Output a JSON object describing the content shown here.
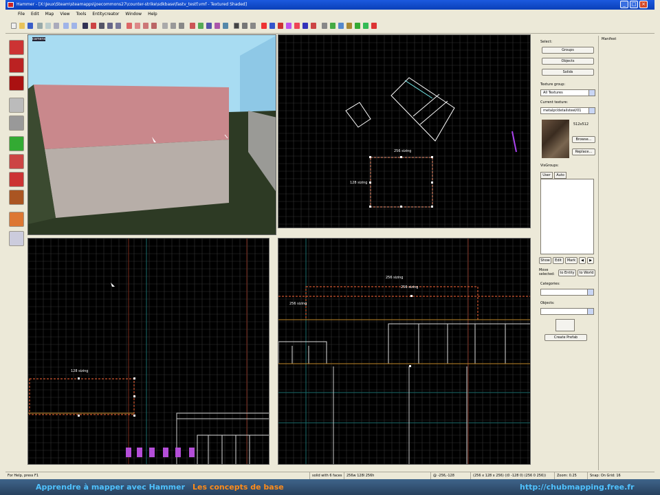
{
  "window": {
    "title": "Hammer - [X:\\Jeux\\Steam\\steamapps\\joecommons27\\counter-strike\\sdkbase\\fastv_testf.vmf - Textured Shaded]",
    "buttons": [
      "_",
      "□",
      "×"
    ]
  },
  "menu": [
    "File",
    "Edit",
    "Map",
    "View",
    "Tools",
    "Entitycreator",
    "Window",
    "Help"
  ],
  "viewports": {
    "camera": {
      "label": "camera"
    },
    "top": {
      "dim_width": "256 sizing",
      "dim_height": "128 sizing"
    },
    "front": {
      "dim_width": "128 sizing"
    },
    "side": {
      "dim_width": "256 sizing",
      "dim_width2": "256 sizing",
      "dim_height": "256 sizing"
    }
  },
  "panel": {
    "select_label": "Select:",
    "select_buttons": [
      "Groups",
      "Objects",
      "Solids"
    ],
    "texture_group_label": "Texture group:",
    "texture_group_value": "All Textures",
    "current_texture_label": "Current texture:",
    "current_texture_value": "metalpr/detailsteel/01",
    "texture_size": "512x512",
    "browse": "Browse...",
    "replace": "Replace...",
    "visgroups_label": "VisGroups:",
    "visgroups_tabs": [
      "User",
      "Auto"
    ],
    "visgroup_buttons": [
      "Show",
      "Edit",
      "Mark",
      "◀",
      "▶"
    ],
    "move_selected_label": "Move selected:",
    "move_buttons": [
      "to Entity",
      "to World"
    ],
    "categories_label": "Categories:",
    "objects_label": "Objects:",
    "create_prefab": "Create Prefab",
    "far_title": "Manifest"
  },
  "status": {
    "help": "For Help, press F1",
    "selection": "solid with 6 faces",
    "size": "256w 128l 256h",
    "coords": "@ -256,-128",
    "bounds": "(256 x 128 x 256) ((0 -128 0) (256 0 256))",
    "zoom": "Zoom: 0.25",
    "snap": "Snap: On Grid: 16"
  },
  "banner": {
    "left": "Apprendre à mapper avec Hammer",
    "middle": "Les concepts de base",
    "right": "http://chubmapping.free.fr"
  },
  "colors": {
    "accent_blue": "#0a3fb8",
    "banner_left": "#4fc2ff",
    "banner_middle": "#ff8c1a",
    "grid": "#333333",
    "selection": "#ff3b3b",
    "wire": "#ffffff",
    "axis": "#1a6b6b"
  }
}
